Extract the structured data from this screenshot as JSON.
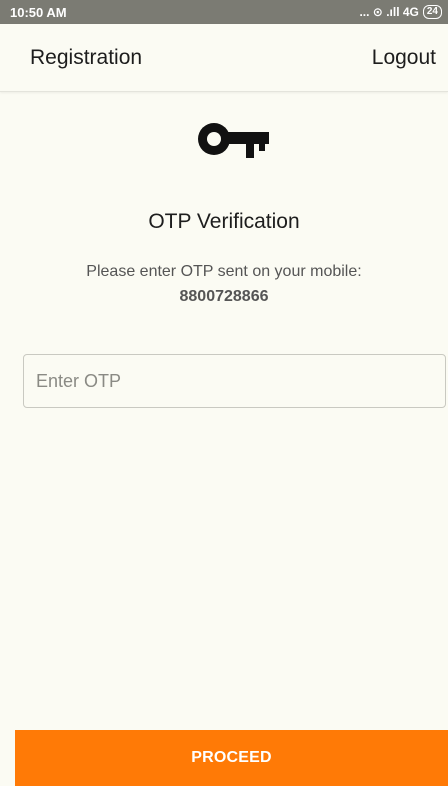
{
  "status_bar": {
    "time": "10:50 AM",
    "signal_text": "... ⊙ .ıll 4G",
    "battery": "24"
  },
  "header": {
    "title": "Registration",
    "logout_label": "Logout"
  },
  "main": {
    "icon": "key-icon",
    "title": "OTP Verification",
    "message": "Please enter OTP sent on your mobile:",
    "phone": "8800728866",
    "otp_placeholder": "Enter OTP",
    "otp_value": ""
  },
  "footer": {
    "proceed_label": "PROCEED"
  },
  "colors": {
    "accent": "#ff7a06",
    "background": "#fbfbf3",
    "status_bar": "#7b7b73"
  }
}
